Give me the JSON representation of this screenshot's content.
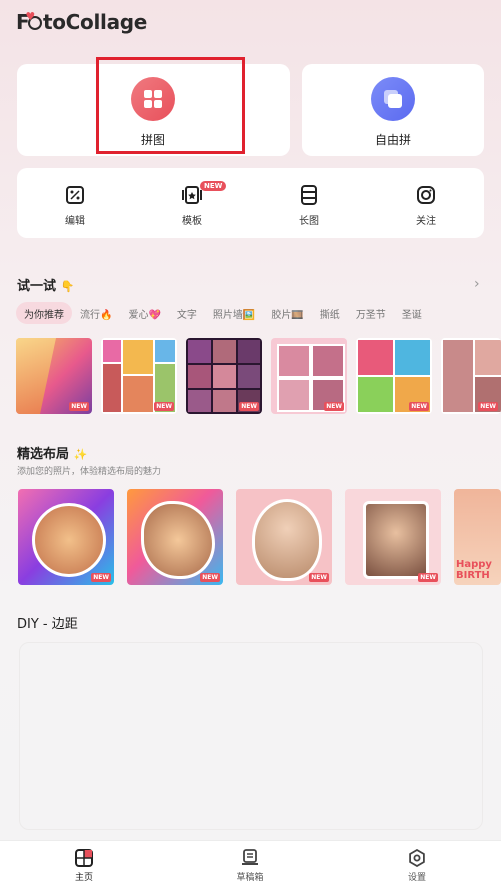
{
  "app": {
    "logo_pre": "F",
    "logo_post": "toCollage"
  },
  "hero": {
    "collage_label": "拼图",
    "free_label": "自由拼"
  },
  "tools": [
    {
      "label": "编辑",
      "icon": "edit-icon"
    },
    {
      "label": "模板",
      "icon": "template-icon",
      "badge": "NEW"
    },
    {
      "label": "长图",
      "icon": "long-image-icon"
    },
    {
      "label": "关注",
      "icon": "instagram-icon"
    }
  ],
  "try_section": {
    "title": "试一试",
    "emoji": "👇",
    "tabs": [
      "为你推荐",
      "流行🔥",
      "爱心💖",
      "文字",
      "照片墙🖼️",
      "胶片🎞️",
      "撕纸",
      "万圣节",
      "圣诞"
    ],
    "thumb_badge": "NEW"
  },
  "layouts_section": {
    "title": "精选布局",
    "emoji": "✨",
    "subtitle": "添加您的照片，体验精选布局的魅力",
    "badge": "NEW",
    "partial_text": "Happy BIRTH"
  },
  "diy_section": {
    "title": "DIY - 边距"
  },
  "bottom_nav": {
    "home": "主页",
    "drafts": "草稿箱",
    "settings": "设置"
  },
  "colors": {
    "accent": "#e8505b",
    "highlight_box": "#e0212e",
    "free_icon": "#5b6af0"
  }
}
